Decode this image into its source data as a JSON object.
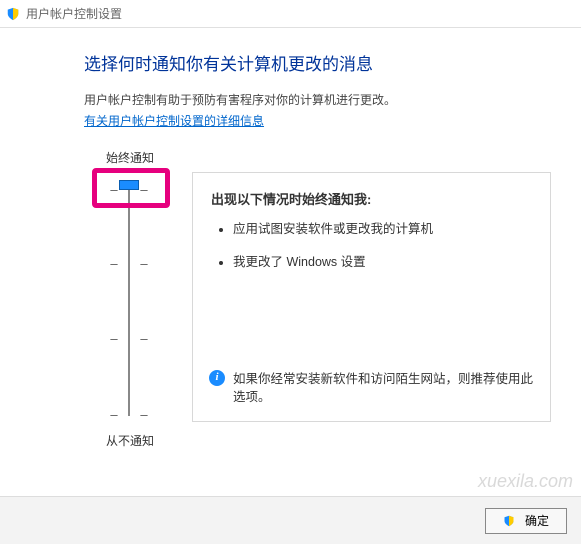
{
  "window": {
    "title": "用户帐户控制设置"
  },
  "heading": "选择何时通知你有关计算机更改的消息",
  "description": "用户帐户控制有助于预防有害程序对你的计算机进行更改。",
  "link_text": "有关用户帐户控制设置的详细信息",
  "slider": {
    "label_top": "始终通知",
    "label_bottom": "从不通知",
    "level_count": 4,
    "selected_level": 1
  },
  "panel": {
    "title": "出现以下情况时始终通知我:",
    "bullets": [
      "应用试图安装软件或更改我的计算机",
      "我更改了 Windows 设置"
    ],
    "recommendation": "如果你经常安装新软件和访问陌生网站，则推荐使用此选项。"
  },
  "buttons": {
    "ok": "确定"
  },
  "watermark": "xuexila.com"
}
